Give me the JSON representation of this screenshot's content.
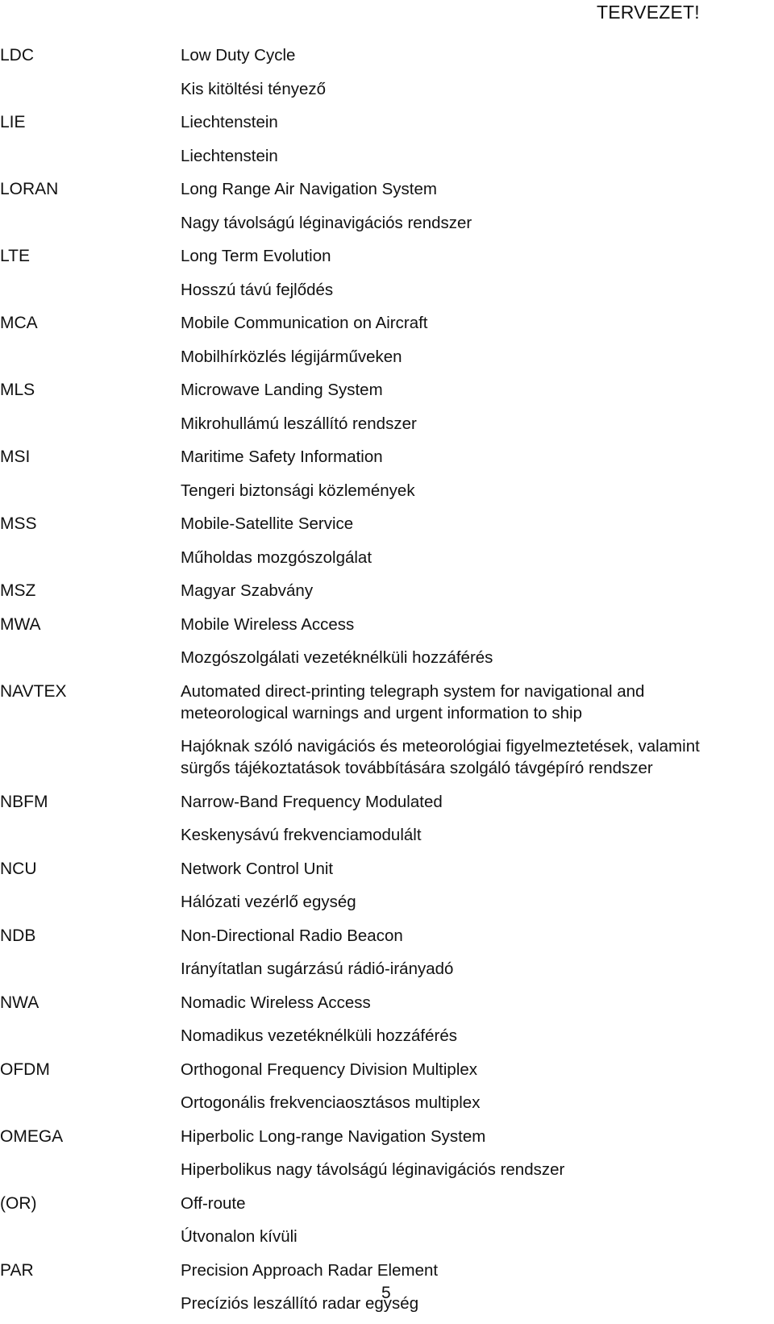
{
  "header": {
    "draft_mark": "TERVEZET!"
  },
  "entries": [
    {
      "abbr": "LDC",
      "en": "Low Duty Cycle",
      "hu": "Kis kitöltési tényező"
    },
    {
      "abbr": "LIE",
      "en": "Liechtenstein",
      "hu": "Liechtenstein"
    },
    {
      "abbr": "LORAN",
      "en": "Long Range Air Navigation System",
      "hu": "Nagy távolságú léginavigációs rendszer"
    },
    {
      "abbr": "LTE",
      "en": "Long Term Evolution",
      "hu": "Hosszú távú fejlődés"
    },
    {
      "abbr": "MCA",
      "en": "Mobile Communication on Aircraft",
      "hu": "Mobilhírközlés légijárműveken"
    },
    {
      "abbr": "MLS",
      "en": "Microwave Landing System",
      "hu": "Mikrohullámú leszállító rendszer"
    },
    {
      "abbr": "MSI",
      "en": "Maritime Safety Information",
      "hu": "Tengeri biztonsági közlemények"
    },
    {
      "abbr": "MSS",
      "en": "Mobile-Satellite Service",
      "hu": "Műholdas mozgószolgálat"
    },
    {
      "abbr": "MSZ",
      "en": "Magyar Szabvány",
      "hu": ""
    },
    {
      "abbr": "MWA",
      "en": "Mobile Wireless Access",
      "hu": "Mozgószolgálati vezetéknélküli hozzáférés"
    },
    {
      "abbr": "NAVTEX",
      "en": "Automated direct-printing telegraph system for navigational and\nmeteorological warnings and urgent information to ship",
      "hu": "Hajóknak szóló navigációs és meteorológiai figyelmeztetések, valamint\nsürgős tájékoztatások továbbítására szolgáló távgépíró rendszer"
    },
    {
      "abbr": "NBFM",
      "en": "Narrow-Band Frequency Modulated",
      "hu": "Keskenysávú frekvenciamodulált"
    },
    {
      "abbr": "NCU",
      "en": "Network Control Unit",
      "hu": "Hálózati vezérlő egység"
    },
    {
      "abbr": "NDB",
      "en": "Non-Directional Radio Beacon",
      "hu": "Irányítatlan sugárzású rádió-irányadó"
    },
    {
      "abbr": "NWA",
      "en": "Nomadic Wireless Access",
      "hu": "Nomadikus vezetéknélküli hozzáférés"
    },
    {
      "abbr": "OFDM",
      "en": "Orthogonal Frequency Division Multiplex",
      "hu": "Ortogonális frekvenciaosztásos multiplex"
    },
    {
      "abbr": "OMEGA",
      "en": "Hiperbolic Long-range Navigation System",
      "hu": "Hiperbolikus nagy távolságú léginavigációs rendszer"
    },
    {
      "abbr": "(OR)",
      "en": "Off-route",
      "hu": "Útvonalon kívüli"
    },
    {
      "abbr": "PAR",
      "en": "Precision Approach Radar Element",
      "hu": "Precíziós leszállító radar egység"
    }
  ],
  "footer": {
    "page_number": "5"
  }
}
